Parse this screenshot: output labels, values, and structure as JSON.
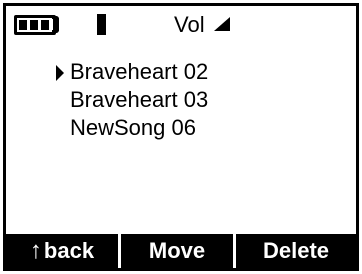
{
  "status_bar": {
    "battery_icon": "battery-icon",
    "battery_cells_filled": 3,
    "battery_cells_total": 3,
    "signal_icon": "signal-bar-icon",
    "volume_label": "Vol",
    "volume_icon": "volume-triangle-icon"
  },
  "list": {
    "selected_index": 0,
    "items": [
      {
        "label": "Braveheart 02"
      },
      {
        "label": "Braveheart 03"
      },
      {
        "label": "NewSong 06"
      }
    ]
  },
  "softkeys": {
    "back_icon": "up-arrow-icon",
    "back_icon_glyph": "↑",
    "back_label": "back",
    "move_label": "Move",
    "delete_label": "Delete"
  }
}
